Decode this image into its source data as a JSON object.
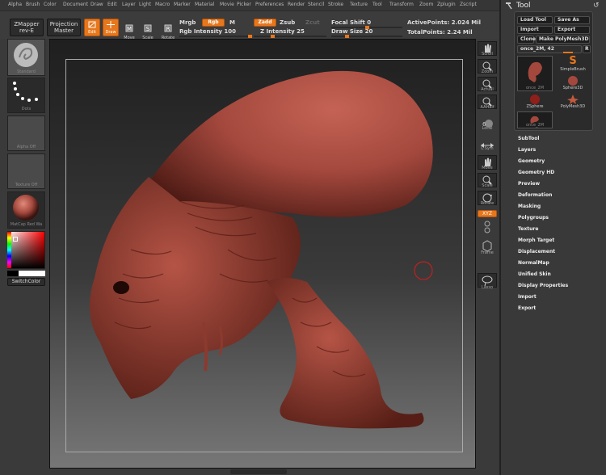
{
  "menu": [
    "Alpha",
    "Brush",
    "Color",
    "Document",
    "Draw",
    "Edit",
    "Layer",
    "Light",
    "Macro",
    "Marker",
    "Material",
    "Movie",
    "Picker",
    "Preferences",
    "Render",
    "Stencil",
    "Stroke",
    "Texture",
    "Tool",
    "Transform",
    "Zoom",
    "Zplugin",
    "Zscript"
  ],
  "toolbar": {
    "zmapper_label": "ZMapper",
    "zmapper_sub": "rev-E",
    "projection_label": "Projection",
    "projection_sub": "Master",
    "edit_label": "Edit",
    "draw_label": "Draw",
    "move_label": "Move",
    "scale_label": "Scale",
    "rotate_label": "Rotate",
    "mrgb_label": "Mrgb",
    "rgb_label": "Rgb",
    "m_label": "M",
    "rgb_intensity_label": "Rgb Intensity 100",
    "zadd_label": "Zadd",
    "zsub_label": "Zsub",
    "zcut_label": "Zcut",
    "z_intensity_label": "Z Intensity 25",
    "focal_shift_label": "Focal Shift 0",
    "draw_size_label": "Draw Size 20",
    "active_points_label": "ActivePoints: 2.024 Mil",
    "total_points_label": "TotalPoints: 2.24 Mil",
    "rgb_intensity_level": 1.0,
    "z_intensity_level": 0.25,
    "focal_shift_level": 0.5,
    "draw_size_level": 0.2
  },
  "left_shelf": {
    "brush_label": "Standard",
    "stroke_label": "Dots",
    "alpha_label": "Alpha Off",
    "texture_label": "Texture Off",
    "material_label": "MatCap Red Wa",
    "switch_color_label": "SwitchColor"
  },
  "right_shelf": [
    "Scroll",
    "Zoom",
    "Actual",
    "AAHalf",
    "Local",
    "L.Sym",
    "Move",
    "Scale",
    "Rotate",
    "Frame",
    "Lasso"
  ],
  "right_shelf_extra": {
    "xyz_label": "XYZ"
  },
  "tool_panel": {
    "title": "Tool",
    "load_tool": "Load Tool",
    "save_as": "Save As",
    "import": "Import",
    "export": "Export",
    "clone": "Clone",
    "make_polymesh": "Make PolyMesh3D",
    "current_tool": "once_2M, 42",
    "r_label": "R",
    "thumbs": [
      "once_2M",
      "SimpleBrush",
      "Sphere3D",
      "ZSphere",
      "PolyMesh3D",
      "once_2M"
    ],
    "subpalettes": [
      "SubTool",
      "Layers",
      "Geometry",
      "Geometry HD",
      "Preview",
      "Deformation",
      "Masking",
      "Polygroups",
      "Texture",
      "Morph Target",
      "Displacement",
      "NormalMap",
      "Unified Skin",
      "Display Properties",
      "Import",
      "Export"
    ]
  },
  "colors": {
    "accent": "#e7771c",
    "model": "#a4483d",
    "panel": "#393939"
  }
}
